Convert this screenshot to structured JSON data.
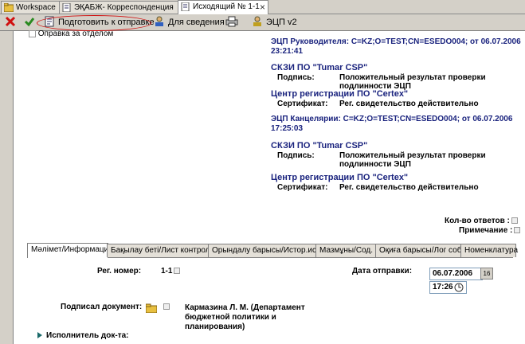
{
  "tabs": [
    {
      "label": "Workspace"
    },
    {
      "label": "ЭҚАБЖ- Корреспонденция"
    },
    {
      "label": "Исходящий № 1-1",
      "active": true
    }
  ],
  "toolbar": {
    "prepare_label": "Подготовить к отправке",
    "info_label": "Для сведения",
    "ecp_label": "ЭЦП v2"
  },
  "header": {
    "checkbox_label": "Оправка за отделом"
  },
  "signatures": [
    {
      "ecp_line1": "ЭЦП Руководителя: C=KZ;O=TEST;CN=ESEDO004; от 06.07.2006",
      "ecp_line2": "23:21:41",
      "skzi": "СКЗИ ПО \"Tumar CSP\"",
      "sign_label": "Подпись:",
      "sign_value_1": "Положительный результат проверки",
      "sign_value_2": "подлинности ЭЦП",
      "center": "Центр регистрации ПО \"Certex\"",
      "cert_label": "Сертификат:",
      "cert_value": "Рег. свидетельство действительно"
    },
    {
      "ecp_line1": "ЭЦП Канцелярии: C=KZ;O=TEST;CN=ESEDO004; от 06.07.2006",
      "ecp_line2": "17:25:03",
      "skzi": "СКЗИ ПО \"Tumar CSP\"",
      "sign_label": "Подпись:",
      "sign_value_1": "Положительный результат проверки",
      "sign_value_2": "подлинности ЭЦП",
      "center": "Центр регистрации ПО \"Certex\"",
      "cert_label": "Сертификат:",
      "cert_value": "Рег. свидетельство действительно"
    }
  ],
  "counts": {
    "answers_label": "Кол-во ответов :",
    "note_label": "Примечание :"
  },
  "form_tabs": [
    "Мәлімет/Информация",
    "Бақылау беті/Лист контроля",
    "Орындалу барысы/Истор.исп.",
    "Мазмұны/Сод.",
    "Оқиға барысы/Лог соб.",
    "Номенклатура"
  ],
  "form": {
    "reg_label": "Рег. номер:",
    "reg_value": "1-1",
    "date_label": "Дата отправки:",
    "date_value": "06.07.2006",
    "date_btn": "16",
    "time_value": "17:26",
    "signed_label": "Подписал документ:",
    "signed_value_1": "Кармазина Л. М. (Департамент",
    "signed_value_2": "бюджетной политики и",
    "signed_value_3": "планирования)",
    "executor_label": "Исполнитель док-та:"
  }
}
